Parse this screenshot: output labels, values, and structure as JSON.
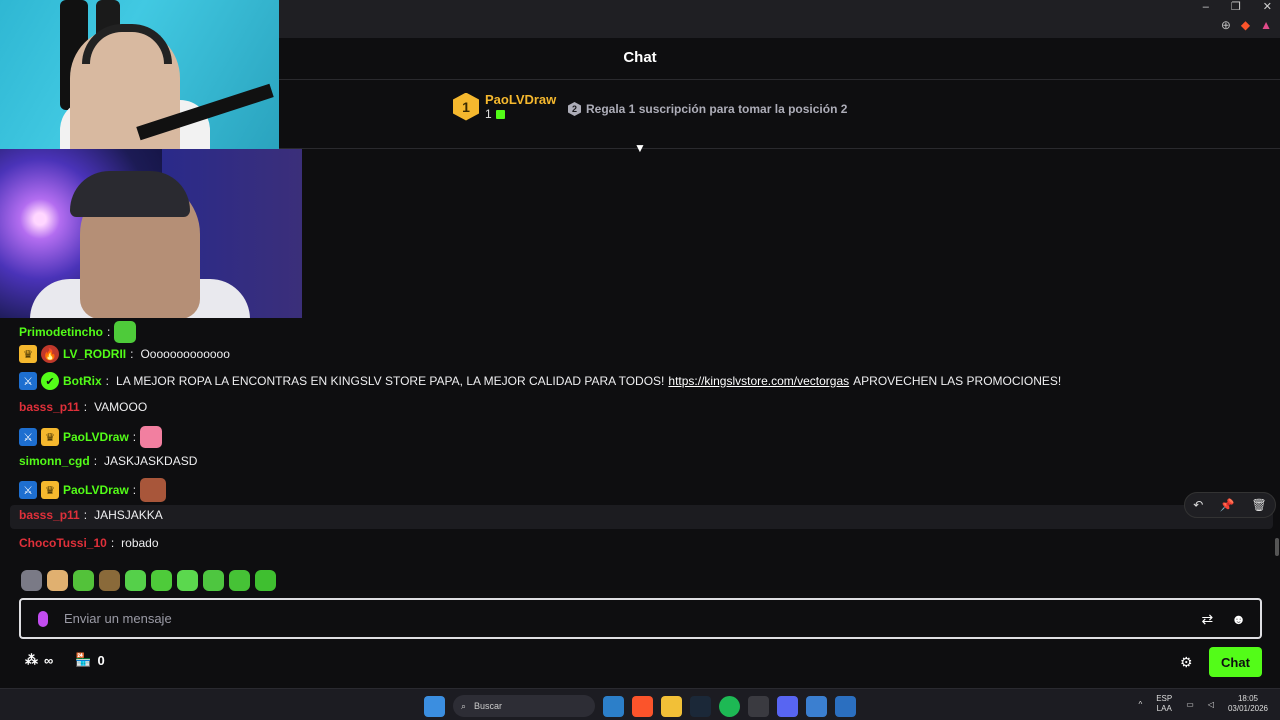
{
  "window": {
    "minimize": "–",
    "maximize": "❐",
    "close": "✕"
  },
  "chat": {
    "title": "Chat",
    "leaderboard": {
      "rank": "1",
      "name": "PaoLVDraw",
      "count": "1",
      "slot2_rank": "2",
      "slot2_text": "Regala 1 suscripción para tomar la posición 2"
    },
    "messages": [
      {
        "user": "Primodetincho",
        "text": "",
        "color": "#53fc18"
      },
      {
        "user": "LV_RODRII",
        "text": "Ooooooooooooo",
        "color": "#53fc18"
      },
      {
        "user": "BotRix",
        "text": "LA MEJOR ROPA LA ENCONTRAS EN KINGSLV STORE PAPA, LA MEJOR CALIDAD PARA TODOS!",
        "link": "https://kingslvstore.com/vectorgas",
        "after": "APROVECHEN LAS PROMOCIONES!",
        "color": "#53fc18"
      },
      {
        "user": "basss_p11",
        "text": "VAMOOO",
        "color": "#e0303a"
      },
      {
        "user": "PaoLVDraw",
        "text": "",
        "color": "#53fc18"
      },
      {
        "user": "simonn_cgd",
        "text": "JASKJASKDASD",
        "color": "#53fc18"
      },
      {
        "user": "PaoLVDraw",
        "text": "",
        "color": "#53fc18"
      },
      {
        "user": "basss_p11",
        "text": "JAHSJAKKA",
        "color": "#e0303a"
      },
      {
        "user": "ChocoTussi_10",
        "text": "robado",
        "color": "#e0303a"
      }
    ],
    "input_placeholder": "Enviar un mensaje",
    "bottom": {
      "count": "0",
      "chat_button": "Chat"
    }
  },
  "taskbar": {
    "search": "Buscar",
    "lang_line1": "ESP",
    "lang_line2": "LAA",
    "time": "18:05",
    "date": "03/01/2026"
  },
  "colors": {
    "accent": "#53fc18",
    "gold": "#f5b82e",
    "mod": "#1e6fd0",
    "background": "#0e0e10"
  }
}
